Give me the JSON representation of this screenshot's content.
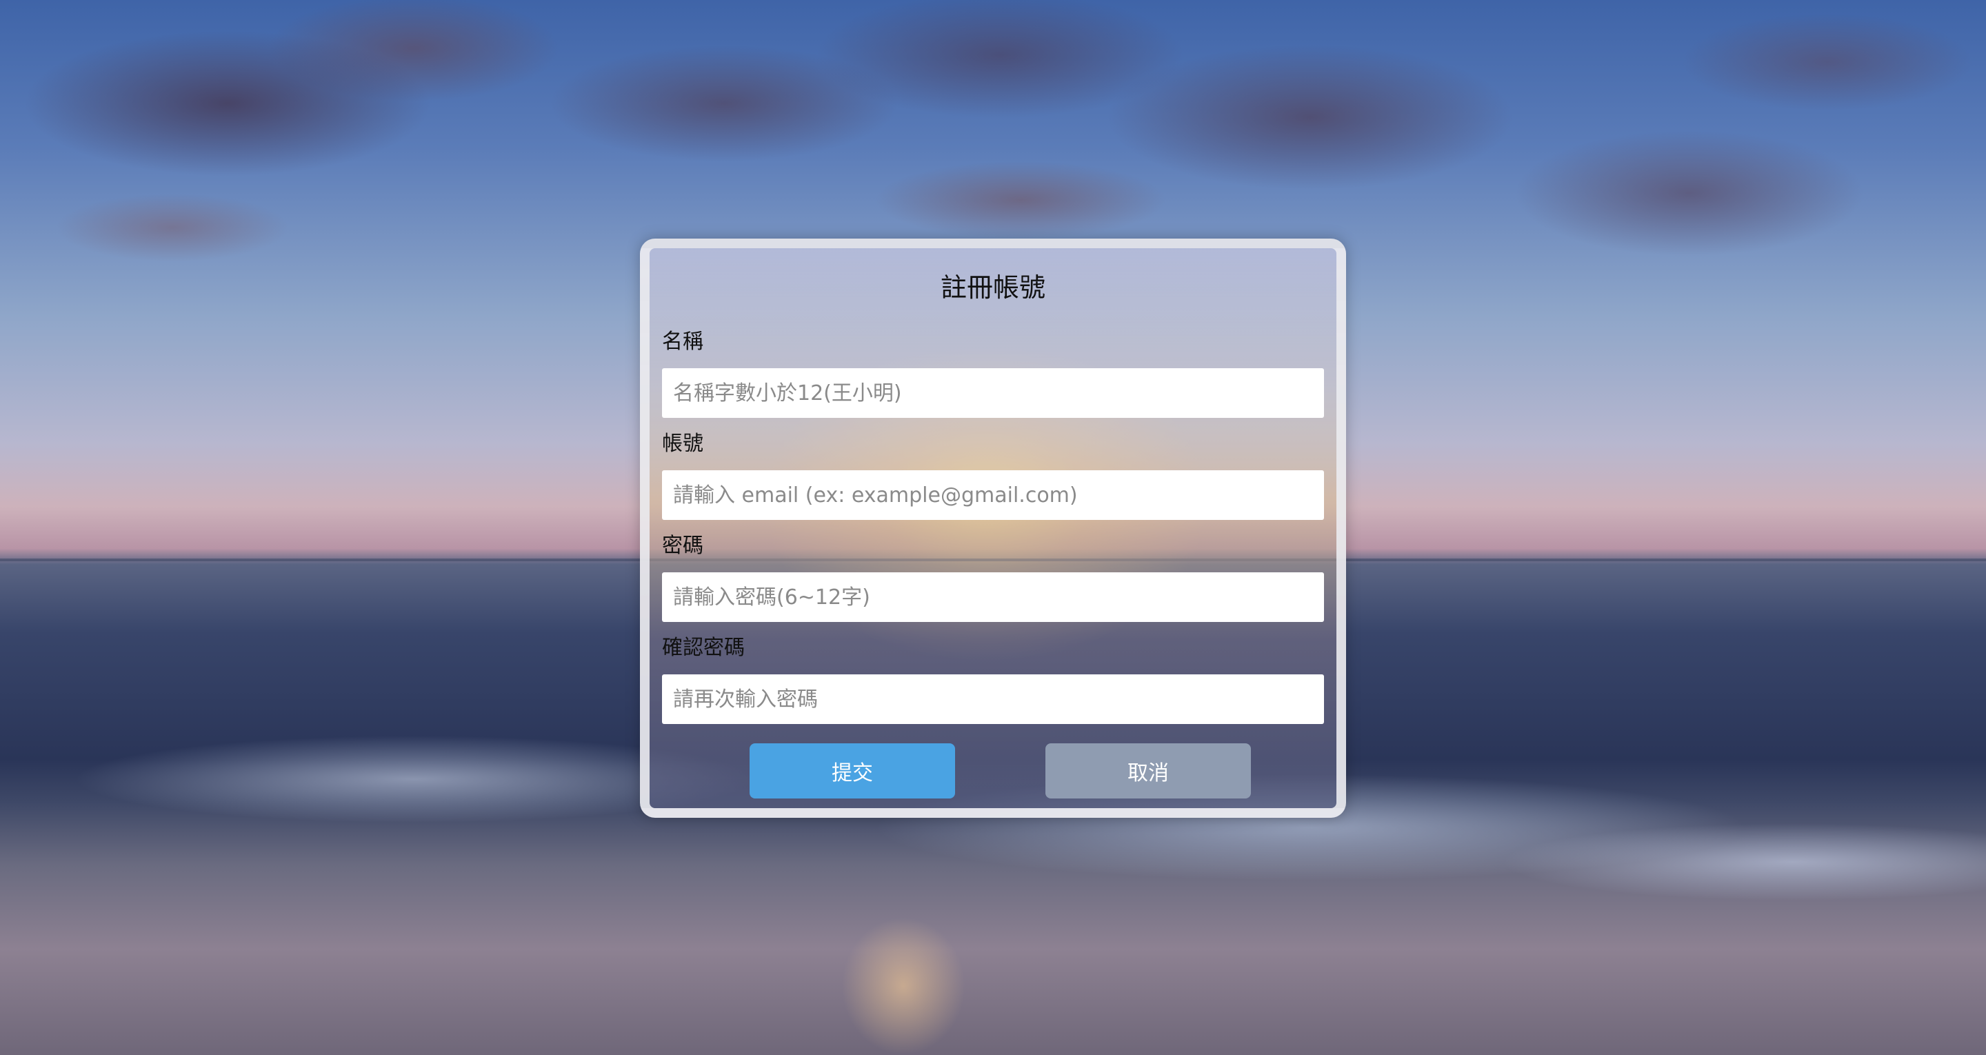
{
  "form": {
    "title": "註冊帳號",
    "fields": [
      {
        "label": "名稱",
        "placeholder": "名稱字數小於12(王小明)",
        "value": ""
      },
      {
        "label": "帳號",
        "placeholder": "請輸入 email (ex: example@gmail.com)",
        "value": ""
      },
      {
        "label": "密碼",
        "placeholder": "請輸入密碼(6~12字)",
        "value": ""
      },
      {
        "label": "確認密碼",
        "placeholder": "請再次輸入密碼",
        "value": ""
      }
    ],
    "submit_label": "提交",
    "cancel_label": "取消"
  },
  "colors": {
    "submit_button": "#4aa3e3",
    "cancel_button": "#8f9cb1"
  }
}
